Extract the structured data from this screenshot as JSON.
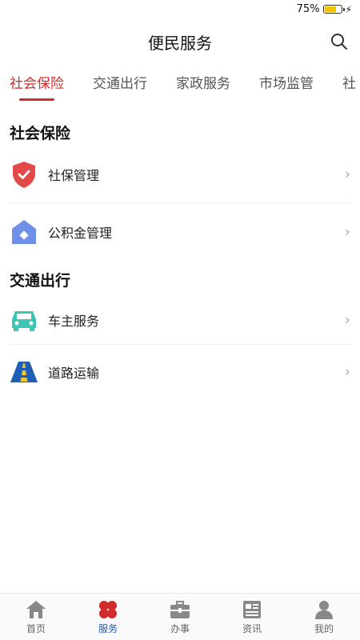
{
  "status": {
    "battery_pct": "75%",
    "battery_level": 0.75,
    "bolt": "⚡"
  },
  "header": {
    "title": "便民服务"
  },
  "tabs": [
    {
      "label": "社会保险"
    },
    {
      "label": "交通出行"
    },
    {
      "label": "家政服务"
    },
    {
      "label": "市场监管"
    },
    {
      "label": "社"
    }
  ],
  "sections": [
    {
      "title": "社会保险",
      "items": [
        {
          "label": "社保管理",
          "icon": "shield-icon"
        },
        {
          "label": "公积金管理",
          "icon": "house-icon"
        }
      ]
    },
    {
      "title": "交通出行",
      "items": [
        {
          "label": "车主服务",
          "icon": "car-icon"
        },
        {
          "label": "道路运输",
          "icon": "road-icon"
        }
      ]
    }
  ],
  "chevron": "›",
  "bottom_nav": [
    {
      "label": "首页",
      "icon": "home-icon"
    },
    {
      "label": "服务",
      "icon": "clover-icon"
    },
    {
      "label": "办事",
      "icon": "briefcase-icon"
    },
    {
      "label": "资讯",
      "icon": "news-icon"
    },
    {
      "label": "我的",
      "icon": "profile-icon"
    }
  ],
  "colors": {
    "accent": "#d22b2b",
    "nav_active": "#1f5fb5"
  }
}
